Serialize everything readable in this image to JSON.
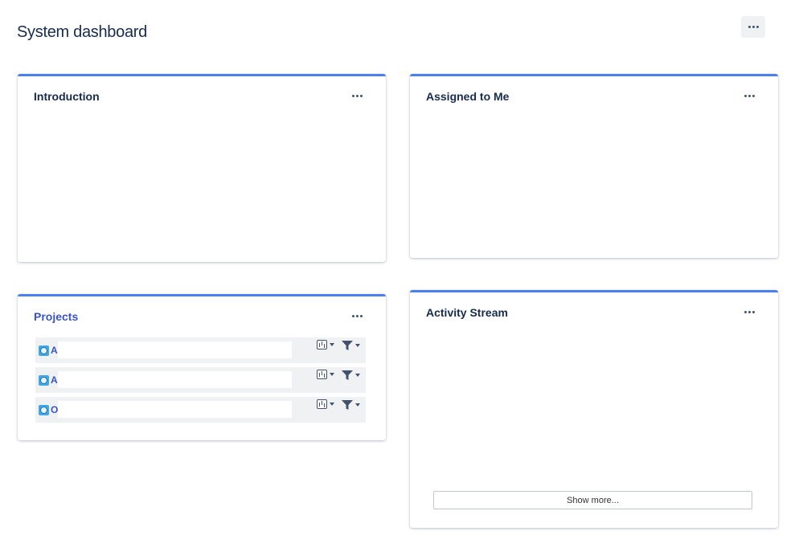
{
  "page": {
    "title": "System dashboard"
  },
  "gadgets": {
    "introduction": {
      "title": "Introduction"
    },
    "assigned": {
      "title": "Assigned to Me"
    },
    "projects": {
      "title": "Projects",
      "rows": [
        {
          "letter": "A"
        },
        {
          "letter": "A"
        },
        {
          "letter": "O"
        }
      ]
    },
    "activity": {
      "title": "Activity Stream",
      "show_more": "Show more..."
    }
  },
  "icons": {
    "menu": "more-horizontal-icon",
    "project": "project-avatar-icon",
    "chart": "chart-icon",
    "filter": "filter-icon",
    "caret": "chevron-down-icon"
  },
  "colors": {
    "accent": "#4c7ff0",
    "link": "#3a53c6",
    "text": "#172b4d"
  }
}
